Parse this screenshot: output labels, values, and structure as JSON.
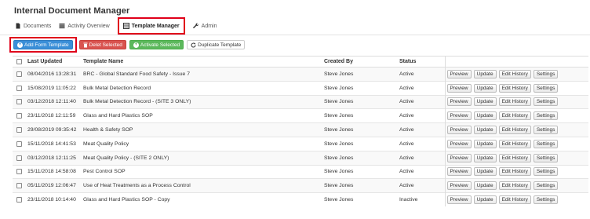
{
  "app": {
    "title": "Internal Document Manager"
  },
  "nav": {
    "documents": "Documents",
    "activity": "Activity Overview",
    "template_manager": "Template Manager",
    "admin": "Admin"
  },
  "toolbar": {
    "add": "Add Form Template",
    "delete": "Delet Selected",
    "activate": "Activate Selected",
    "duplicate": "Duplicate Template"
  },
  "table": {
    "headers": [
      "Last Updated",
      "Template Name",
      "Created By",
      "Status"
    ],
    "actions": [
      "Preview",
      "Update",
      "Edit History",
      "Settings"
    ],
    "rows": [
      {
        "date": "08/04/2016 13:28:31",
        "name": "BRC - Global Standard Food Safety - Issue 7",
        "by": "Steve Jones",
        "status": "Active"
      },
      {
        "date": "15/08/2019 11:05:22",
        "name": "Bulk Metal Detection Record",
        "by": "Steve Jones",
        "status": "Active"
      },
      {
        "date": "03/12/2018 12:11:40",
        "name": "Bulk Metal Detection Record - (SITE 3 ONLY)",
        "by": "Steve Jones",
        "status": "Active"
      },
      {
        "date": "23/11/2018 12:11:59",
        "name": "Glass and Hard Plastics SOP",
        "by": "Steve Jones",
        "status": "Active"
      },
      {
        "date": "29/08/2019 09:35:42",
        "name": "Health & Safety SOP",
        "by": "Steve Jones",
        "status": "Active"
      },
      {
        "date": "15/11/2018 14:41:53",
        "name": "Meat Quality Policy",
        "by": "Steve Jones",
        "status": "Active"
      },
      {
        "date": "03/12/2018 12:11:25",
        "name": "Meat Quality Policy - (SITE 2 ONLY)",
        "by": "Steve Jones",
        "status": "Active"
      },
      {
        "date": "15/11/2018 14:58:08",
        "name": "Pest Control SOP",
        "by": "Steve Jones",
        "status": "Active"
      },
      {
        "date": "05/11/2019 12:06:47",
        "name": "Use of Heat Treatments as a Process Control",
        "by": "Steve Jones",
        "status": "Active"
      },
      {
        "date": "23/11/2018 10:14:40",
        "name": "Glass and Hard Plastics SOP - Copy",
        "by": "Steve Jones",
        "status": "Inactive"
      }
    ]
  },
  "colors": {
    "highlight": "#e0001a",
    "primary": "#3a8fd8",
    "danger": "#d9534f",
    "success": "#5cb85c"
  }
}
